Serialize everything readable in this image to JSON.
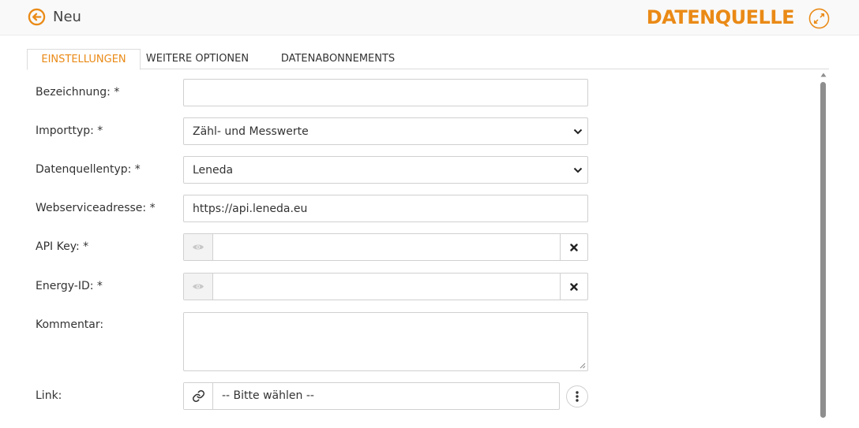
{
  "header": {
    "back_label": "Neu",
    "title": "DATENQUELLE",
    "back_icon": "arrow-left-circle-icon",
    "expand_icon": "expand-icon",
    "accent_color": "#ea8a16"
  },
  "tabs": [
    {
      "label": "EINSTELLUNGEN",
      "active": true
    },
    {
      "label": "WEITERE OPTIONEN",
      "active": false
    },
    {
      "label": "DATENABONNEMENTS",
      "active": false
    }
  ],
  "form": {
    "bezeichnung": {
      "label": "Bezeichnung: *",
      "value": ""
    },
    "importtyp": {
      "label": "Importtyp: *",
      "selected": "Zähl- und Messwerte"
    },
    "datenquellentyp": {
      "label": "Datenquellentyp: *",
      "selected": "Leneda"
    },
    "webserviceadresse": {
      "label": "Webserviceadresse: *",
      "value": "https://api.leneda.eu"
    },
    "api_key": {
      "label": "API Key: *",
      "value": ""
    },
    "energy_id": {
      "label": "Energy-ID: *",
      "value": ""
    },
    "kommentar": {
      "label": "Kommentar:",
      "value": ""
    },
    "link": {
      "label": "Link:",
      "value": "-- Bitte wählen --"
    }
  },
  "icons": {
    "eye": "eye-icon",
    "clear": "close-icon",
    "link": "link-icon",
    "more": "more-vertical-icon",
    "chevron": "chevron-down-icon"
  }
}
